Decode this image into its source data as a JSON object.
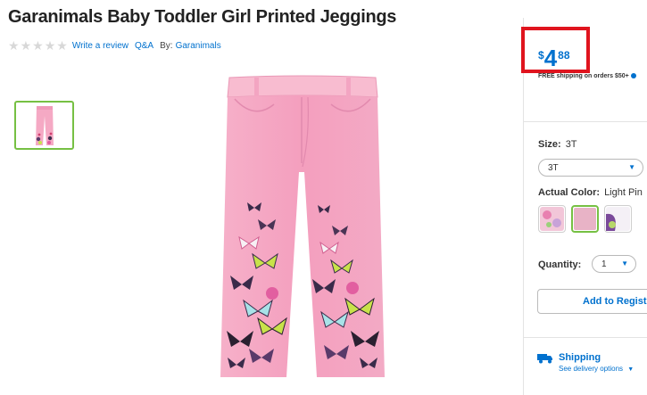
{
  "product": {
    "title": "Garanimals Baby Toddler Girl Printed Jeggings",
    "rating_stars": 0,
    "write_review": "Write a review",
    "qa": "Q&A",
    "by_label": "By:",
    "brand": "Garanimals"
  },
  "price": {
    "currency": "$",
    "dollars": "4",
    "cents": "88",
    "shipping_note": "FREE shipping on orders $50+"
  },
  "options": {
    "size_label": "Size:",
    "size_value": "3T",
    "size_selected": "3T",
    "color_label": "Actual Color:",
    "color_value": "Light Pin",
    "quantity_label": "Quantity:",
    "quantity_value": "1"
  },
  "actions": {
    "registry": "Add to Registry"
  },
  "shipping": {
    "title": "Shipping",
    "link": "See delivery options"
  },
  "colors": {
    "accent": "#0071ce",
    "highlight": "#e0141e",
    "selected": "#76c043",
    "product_pink": "#f5a9c4"
  }
}
